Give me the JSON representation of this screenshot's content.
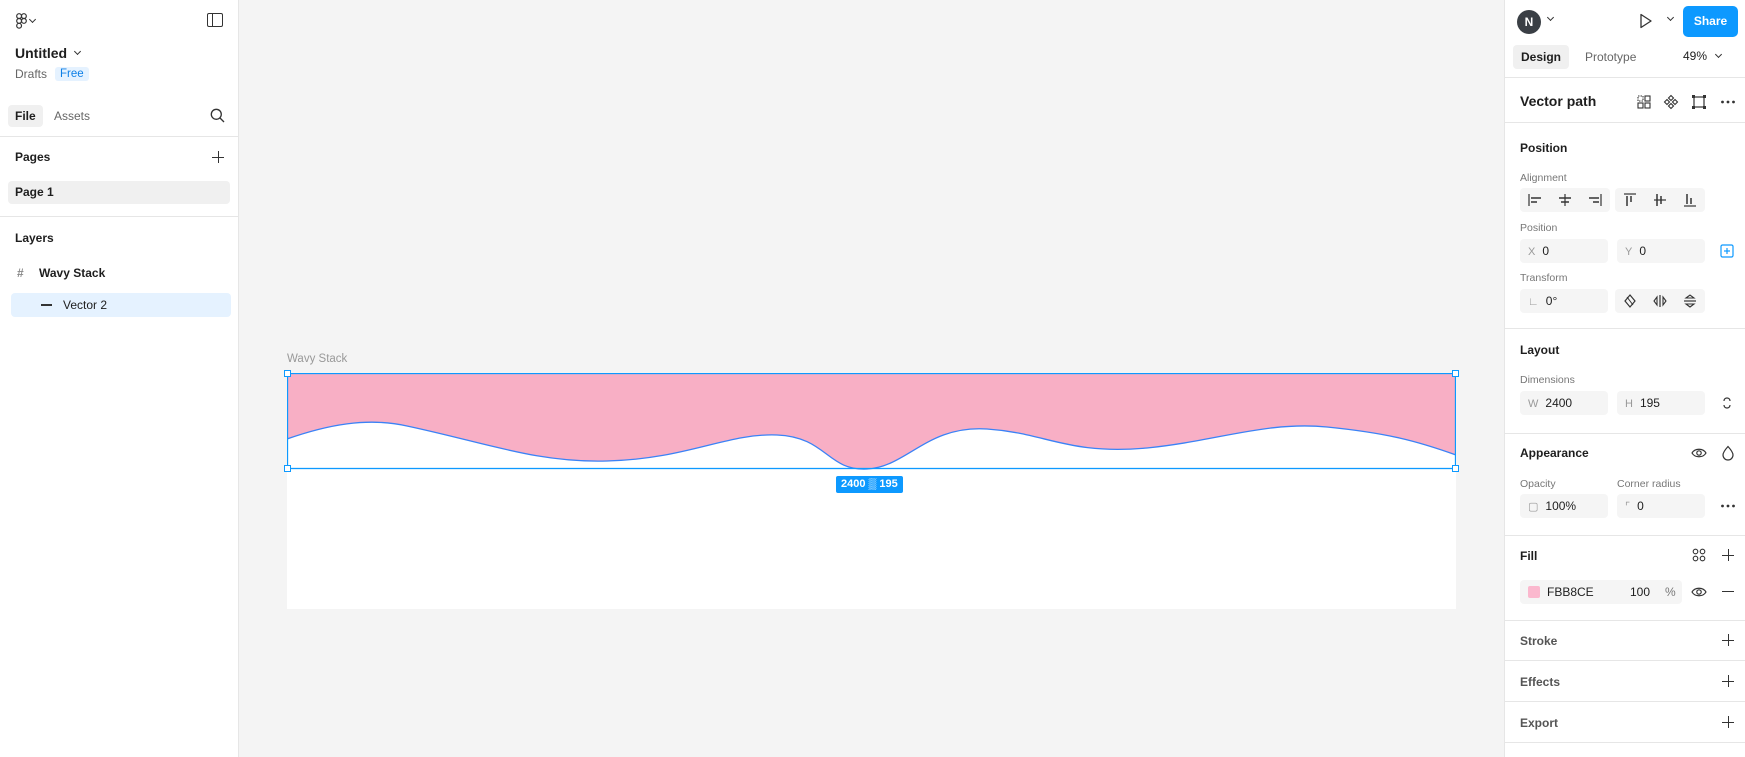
{
  "left": {
    "file_title": "Untitled",
    "drafts": "Drafts",
    "plan_badge": "Free",
    "tabs": [
      {
        "label": "File"
      },
      {
        "label": "Assets"
      }
    ],
    "pages_header": "Pages",
    "pages": [
      {
        "label": "Page 1"
      }
    ],
    "layers_header": "Layers",
    "layers": [
      {
        "label": "Wavy Stack"
      },
      {
        "label": "Vector 2"
      }
    ]
  },
  "canvas": {
    "frame_label": "Wavy Stack",
    "dimension_readout": "2400 ▒ 195",
    "fill_color": "#F8AFC5",
    "stroke_color": "#0D99FF"
  },
  "right": {
    "avatar_initial": "N",
    "share_label": "Share",
    "tabs": [
      {
        "label": "Design"
      },
      {
        "label": "Prototype"
      }
    ],
    "zoom": "49%",
    "selection_title": "Vector path",
    "position_header": "Position",
    "alignment_label": "Alignment",
    "position_label": "Position",
    "x_label": "X",
    "x_value": "0",
    "y_label": "Y",
    "y_value": "0",
    "transform_label": "Transform",
    "rotation_value": "0°",
    "layout_header": "Layout",
    "dimensions_label": "Dimensions",
    "w_label": "W",
    "w_value": "2400",
    "h_label": "H",
    "h_value": "195",
    "appearance_header": "Appearance",
    "opacity_label": "Opacity",
    "opacity_value": "100%",
    "corner_label": "Corner radius",
    "corner_value": "0",
    "fill_header": "Fill",
    "fill_hex": "FBB8CE",
    "fill_opacity": "100",
    "fill_pct": "%",
    "fill_swatch": "#FBB8CE",
    "stroke_header": "Stroke",
    "effects_header": "Effects",
    "export_header": "Export"
  }
}
